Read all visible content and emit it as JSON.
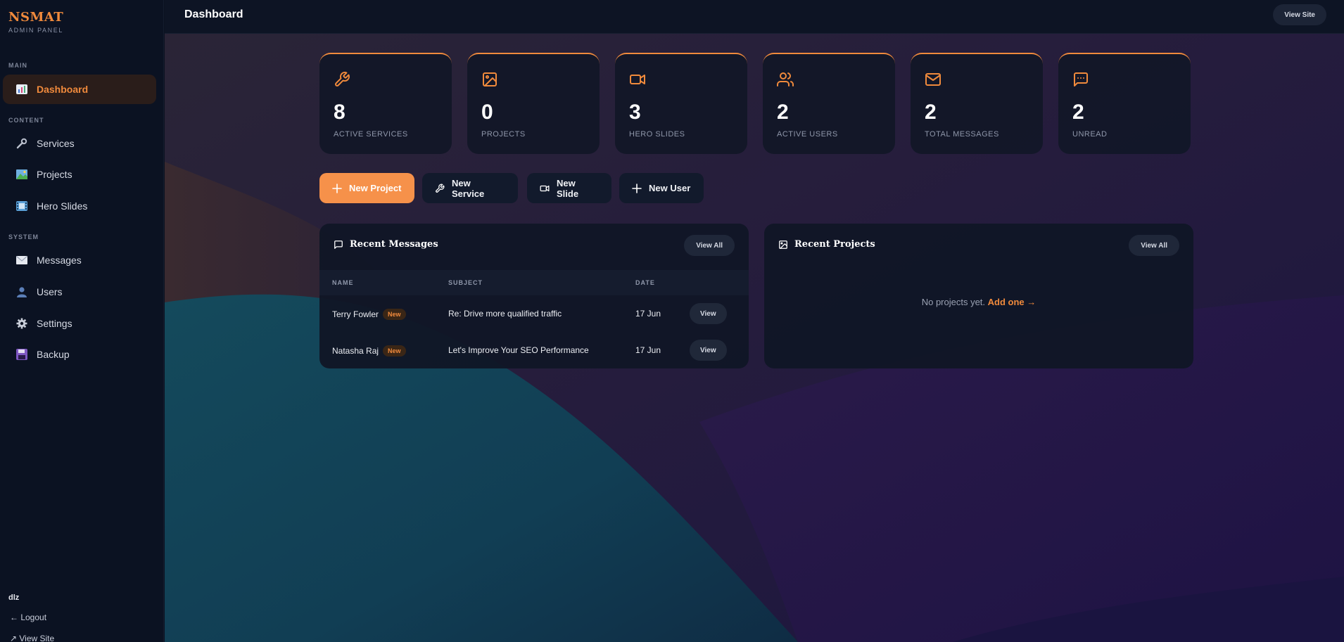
{
  "brand": {
    "name": "NSMAT",
    "subtitle": "ADMIN PANEL",
    "accent": "#f08a3c"
  },
  "sidebar": {
    "sections": {
      "main": "MAIN",
      "content": "CONTENT",
      "system": "SYSTEM"
    },
    "items": [
      {
        "label": "Dashboard",
        "icon": "bar-chart-icon",
        "active": true
      },
      {
        "label": "Services",
        "icon": "wrench-icon"
      },
      {
        "label": "Projects",
        "icon": "picture-icon"
      },
      {
        "label": "Hero Slides",
        "icon": "film-icon"
      },
      {
        "label": "Messages",
        "icon": "envelope-icon"
      },
      {
        "label": "Users",
        "icon": "user-icon"
      },
      {
        "label": "Settings",
        "icon": "gear-icon"
      },
      {
        "label": "Backup",
        "icon": "floppy-disk-icon"
      }
    ],
    "user": "dlz",
    "logout": "← Logout",
    "view_site": "↗ View Site"
  },
  "header": {
    "title": "Dashboard",
    "view_site": "View Site"
  },
  "stats": [
    {
      "value": "8",
      "label": "ACTIVE SERVICES",
      "icon": "wrench-icon"
    },
    {
      "value": "0",
      "label": "PROJECTS",
      "icon": "image-icon"
    },
    {
      "value": "3",
      "label": "HERO SLIDES",
      "icon": "video-icon"
    },
    {
      "value": "2",
      "label": "ACTIVE USERS",
      "icon": "users-icon"
    },
    {
      "value": "2",
      "label": "TOTAL MESSAGES",
      "icon": "mail-icon"
    },
    {
      "value": "2",
      "label": "UNREAD",
      "icon": "message-square-icon"
    }
  ],
  "actions": [
    {
      "label": "New Project",
      "icon": "plus-icon"
    },
    {
      "label": "New Service",
      "icon": "wrench-icon"
    },
    {
      "label": "New Slide",
      "icon": "video-icon"
    },
    {
      "label": "New User",
      "icon": "plus-icon"
    }
  ],
  "recent_messages": {
    "title": "Recent Messages",
    "view_all": "View All",
    "columns": [
      "NAME",
      "SUBJECT",
      "DATE"
    ],
    "rows": [
      {
        "name": "Terry Fowler",
        "badge": "New",
        "subject": "Re: Drive more qualified traffic",
        "date": "17 Jun",
        "action": "View"
      },
      {
        "name": "Natasha Raj",
        "badge": "New",
        "subject": "Let's Improve Your SEO Performance",
        "date": "17 Jun",
        "action": "View"
      }
    ]
  },
  "recent_projects": {
    "title": "Recent Projects",
    "view_all": "View All",
    "empty_text": "No projects yet.",
    "empty_link": "Add one →"
  }
}
